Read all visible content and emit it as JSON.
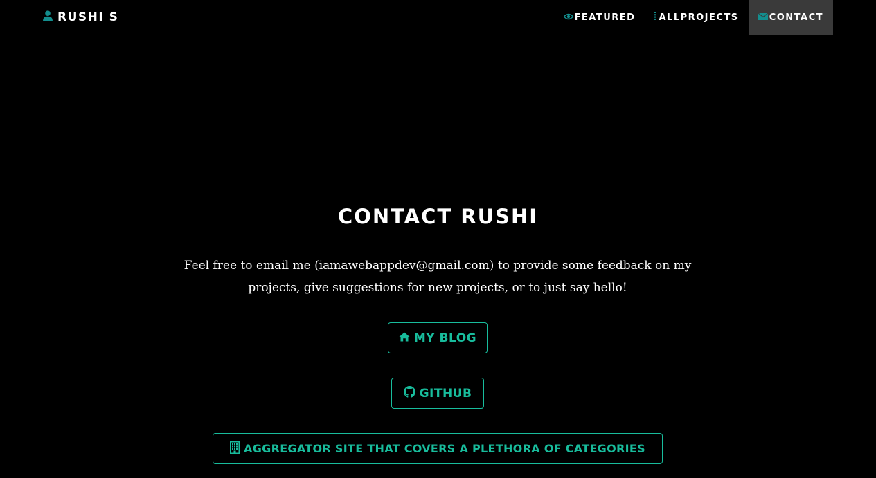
{
  "brand": {
    "name": "RUSHI S",
    "icon": "user-icon"
  },
  "nav": {
    "featured": "FEATURED",
    "allprojects": "ALLPROJECTS",
    "contact": "CONTACT"
  },
  "main": {
    "title": "CONTACT RUSHI",
    "description": "Feel free to email me (iamawebappdev@gmail.com) to provide some feedback on my projects, give suggestions for new projects, or to just say hello!",
    "buttons": {
      "blog": "MY BLOG",
      "github": "GITHUB",
      "aggregator": "AGGREGATOR SITE THAT COVERS A PLETHORA OF CATEGORIES"
    }
  },
  "colors": {
    "accent": "#18bc9c",
    "icon_teal": "#138e8e",
    "background": "#000000",
    "active_nav": "#3a3a3a"
  }
}
